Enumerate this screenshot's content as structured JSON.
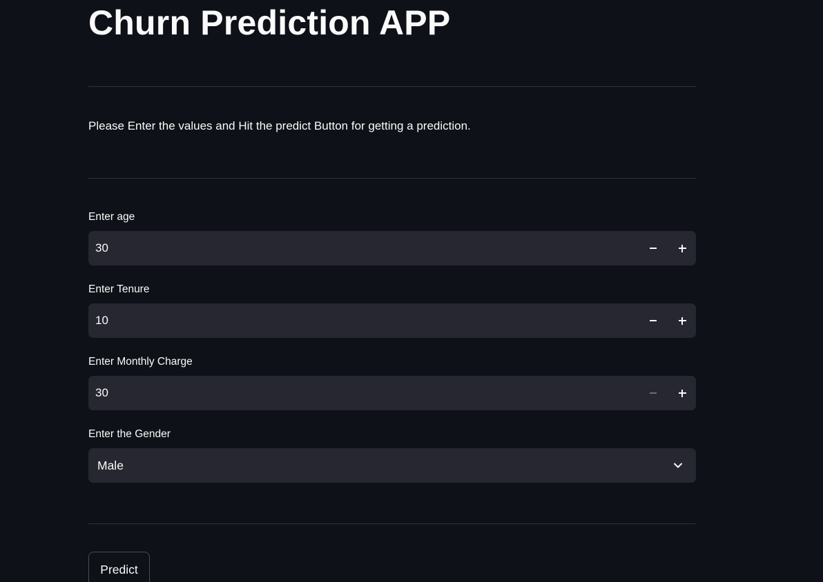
{
  "header": {
    "title": "Churn Prediction APP"
  },
  "intro": {
    "text": "Please Enter the values and Hit the predict Button for getting a prediction."
  },
  "fields": {
    "age": {
      "label": "Enter age",
      "value": "30"
    },
    "tenure": {
      "label": "Enter Tenure",
      "value": "10"
    },
    "monthly_charge": {
      "label": "Enter Monthly Charge",
      "value": "30"
    },
    "gender": {
      "label": "Enter the Gender",
      "selected": "Male"
    }
  },
  "actions": {
    "predict_label": "Predict"
  },
  "icons": {
    "decrement": "minus-icon",
    "increment": "plus-icon",
    "dropdown": "chevron-down-icon"
  },
  "colors": {
    "background": "#0e1117",
    "input_background": "#262730",
    "text": "#fafafa",
    "divider": "#2f323c"
  }
}
